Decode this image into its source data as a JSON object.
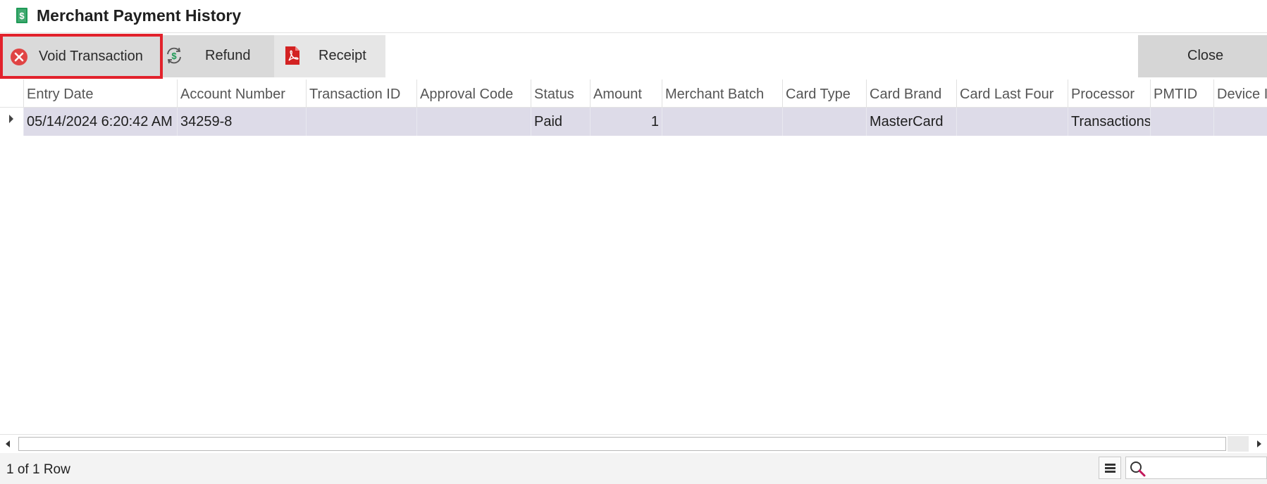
{
  "window": {
    "title": "Merchant Payment History",
    "icon": "dollar-document-icon"
  },
  "toolbar": {
    "void_label": "Void Transaction",
    "refund_label": "Refund",
    "receipt_label": "Receipt",
    "close_label": "Close"
  },
  "grid": {
    "columns": [
      "Entry Date",
      "Account Number",
      "Transaction ID",
      "Approval Code",
      "Status",
      "Amount",
      "Merchant Batch",
      "Card Type",
      "Card Brand",
      "Card Last Four",
      "Processor",
      "PMTID",
      "Device I"
    ],
    "rows": [
      [
        "05/14/2024 6:20:42 AM",
        "34259-8",
        "",
        "",
        "Paid",
        "1",
        "",
        "",
        "MasterCard",
        "",
        "Transactions",
        "",
        ""
      ]
    ]
  },
  "status": {
    "row_count": "1 of 1 Row",
    "search_placeholder": ""
  },
  "colors": {
    "highlight_border": "#e2222c",
    "selected_row": "#dddbe8",
    "toolbar_button": "#dcdcdc"
  }
}
